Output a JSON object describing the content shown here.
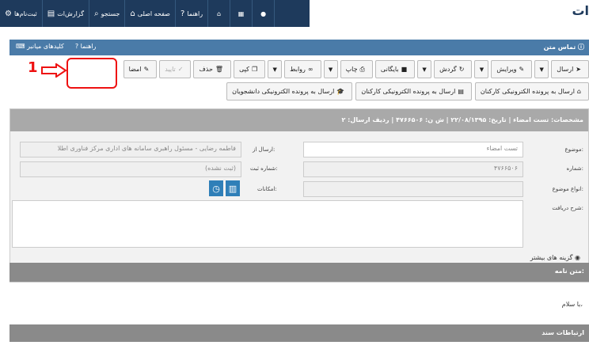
{
  "topnav": {
    "items": [
      {
        "label": "ثبت‌نام‌ها",
        "icon": "cogs-icon"
      },
      {
        "label": "گزارش‌ات",
        "icon": "chart-icon"
      },
      {
        "label": "جستجو",
        "icon": "search-icon"
      },
      {
        "label": "صفحه اصلی",
        "icon": "home-icon"
      },
      {
        "label": "راهنما",
        "icon": "help-icon"
      }
    ],
    "icons": [
      "bank-icon",
      "grid-icon",
      "user-icon"
    ],
    "brand": "ات"
  },
  "panel": {
    "title": "تماس متن",
    "links": [
      {
        "label": "کلیدهای میانبر",
        "icon": "keyboard-icon"
      },
      {
        "label": "راهنما",
        "icon": "help-icon"
      }
    ]
  },
  "toolbar": {
    "send": "ارسال",
    "edit": "ویرایش",
    "flow": "گردش",
    "archive": "بایگانی",
    "print": "چاپ",
    "links": "روابط",
    "copy": "کپی",
    "delete": "حذف",
    "confirm": "تایید",
    "sign": "امضا"
  },
  "send_buttons": [
    {
      "label": "ارسال به پرونده الکترونیکی کارکنان",
      "icon": "bank-icon"
    },
    {
      "label": "ارسال به پرونده الکترونیکی کارکنان",
      "icon": "doc-icon"
    },
    {
      "label": "ارسال به پرونده الکترونیکی دانشجویان",
      "icon": "graduation-icon"
    }
  ],
  "annotation": {
    "number": "1"
  },
  "details": {
    "header": "مشخصات: تست امضاء | تاریخ: ۲۲/۰۸/۱۳۹۵ | ش ن: ۴۷۶۶۵۰۶ | ردیف ارسال: ۲",
    "subject_label": "موضوع:",
    "subject_value": "تست امضاء",
    "number_label": "شماره:",
    "number_value": "۴۷۶۶۵۰۶",
    "type_label": "انواع موضوع:",
    "desc_label": "شرح دریافت:",
    "from_label": "ارسال از:",
    "from_value": "فاطمه رضایی - مسئول راهبری سامانه های اداری مرکز فناوری اطلا",
    "regno_label": "شماره ثبت:",
    "regno_value": "(ثبت نشده)",
    "options_label": "امکانات:",
    "more_options": "گزینه های بیشتر"
  },
  "letter": {
    "header": "متن نامه:",
    "body": "با سلام،"
  },
  "relations": {
    "header": "ارتباطات سند"
  }
}
